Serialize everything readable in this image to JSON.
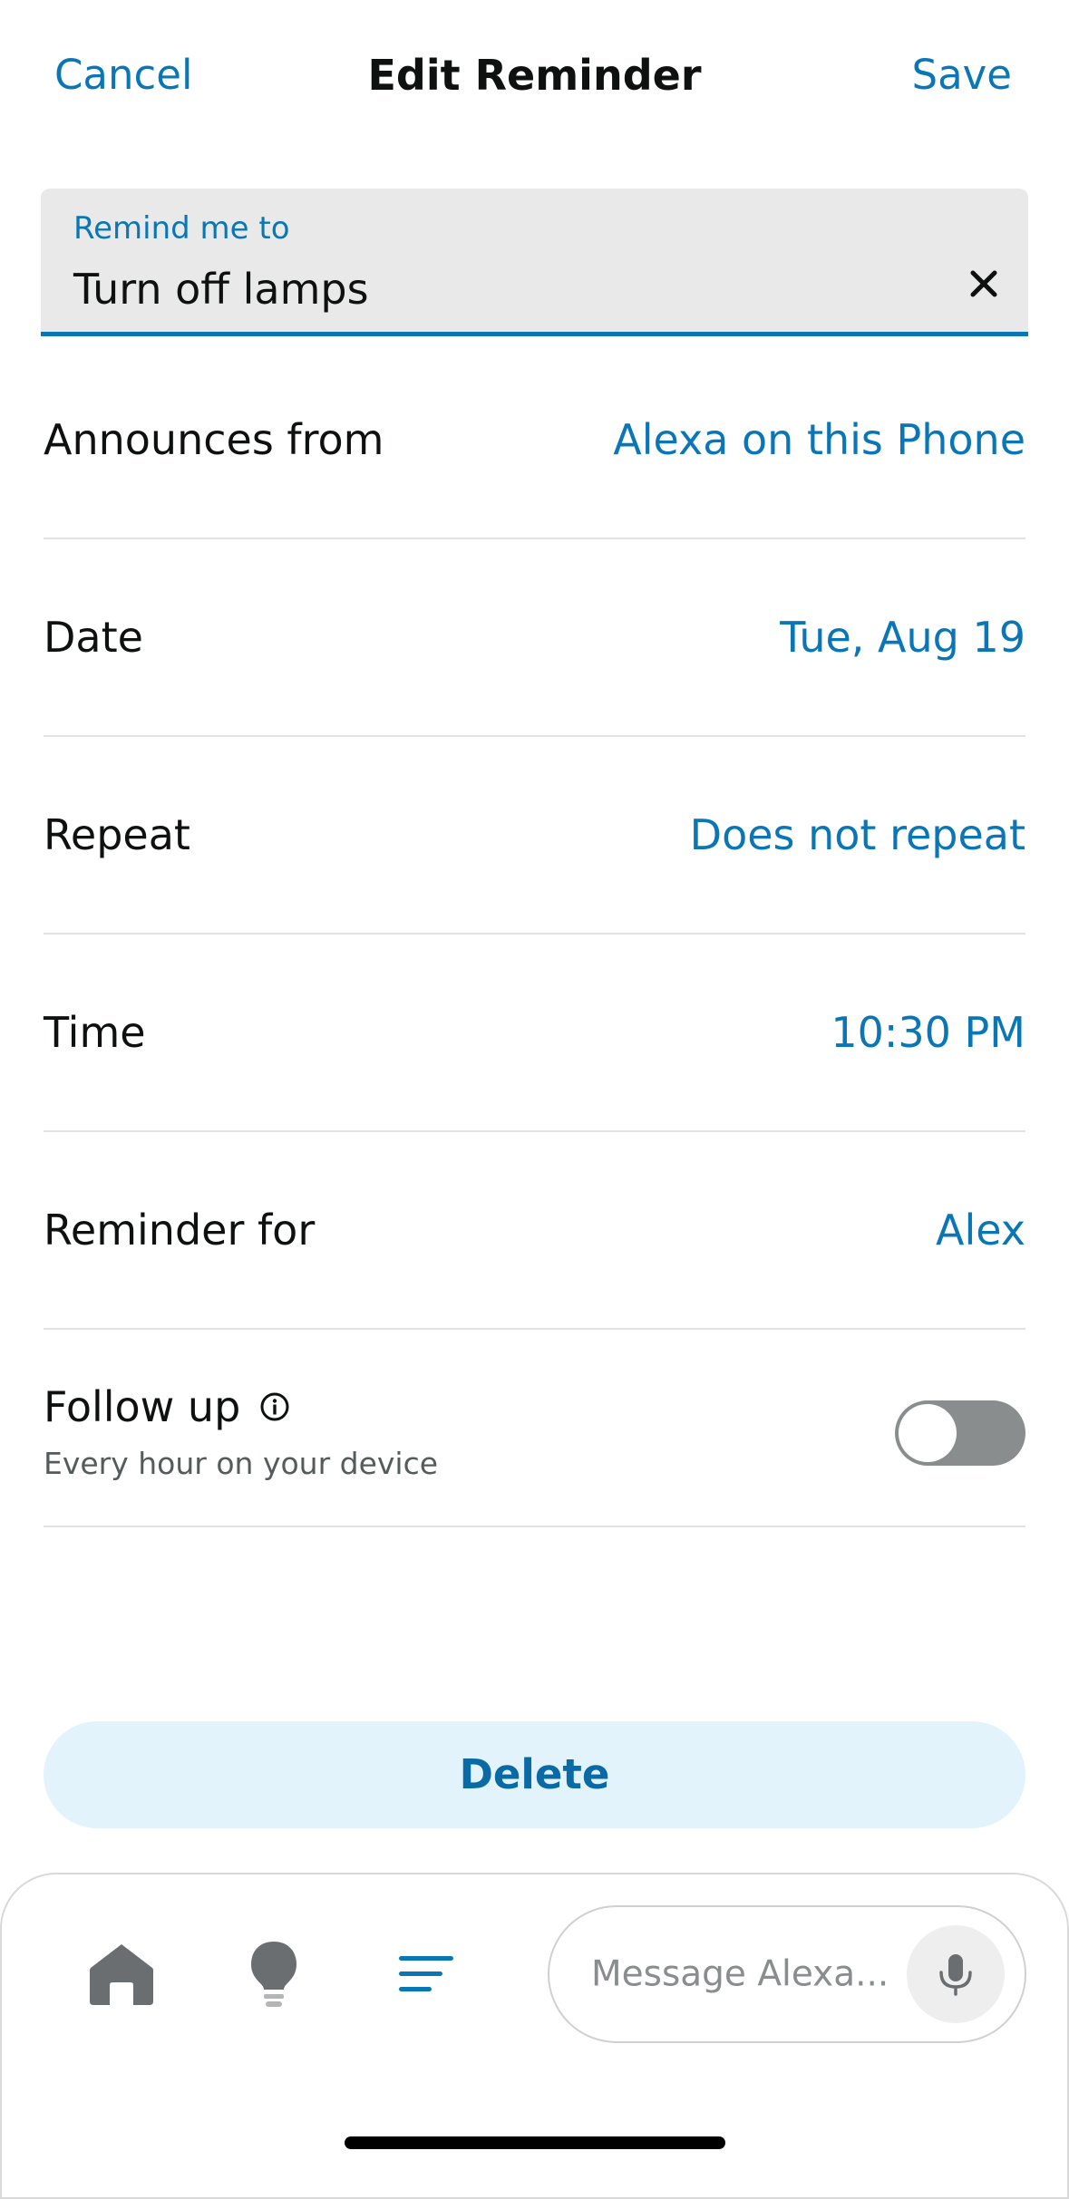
{
  "header": {
    "cancel_label": "Cancel",
    "title": "Edit Reminder",
    "save_label": "Save"
  },
  "remind": {
    "label": "Remind me to",
    "value": "Turn off lamps",
    "clear_icon": "close-icon"
  },
  "rows": [
    {
      "label": "Announces from",
      "value": "Alexa on this Phone"
    },
    {
      "label": "Date",
      "value": "Tue, Aug 19"
    },
    {
      "label": "Repeat",
      "value": "Does not repeat"
    },
    {
      "label": "Time",
      "value": "10:30 PM"
    },
    {
      "label": "Reminder for",
      "value": "Alex"
    }
  ],
  "follow_up": {
    "label": "Follow up",
    "subtitle": "Every hour on your device",
    "info_icon": "info-icon",
    "enabled": false
  },
  "delete_label": "Delete",
  "bottom_nav": {
    "items": [
      {
        "icon": "home-icon"
      },
      {
        "icon": "lightbulb-icon"
      },
      {
        "icon": "menu-lines-icon",
        "active": true
      }
    ],
    "message_placeholder": "Message Alexa...",
    "mic_icon": "microphone-icon"
  },
  "colors": {
    "accent": "#0a76b6",
    "delete_bg": "#e3f3fb",
    "toggle_off": "#8a8d8e",
    "nav_icon": "#6b6e70"
  }
}
